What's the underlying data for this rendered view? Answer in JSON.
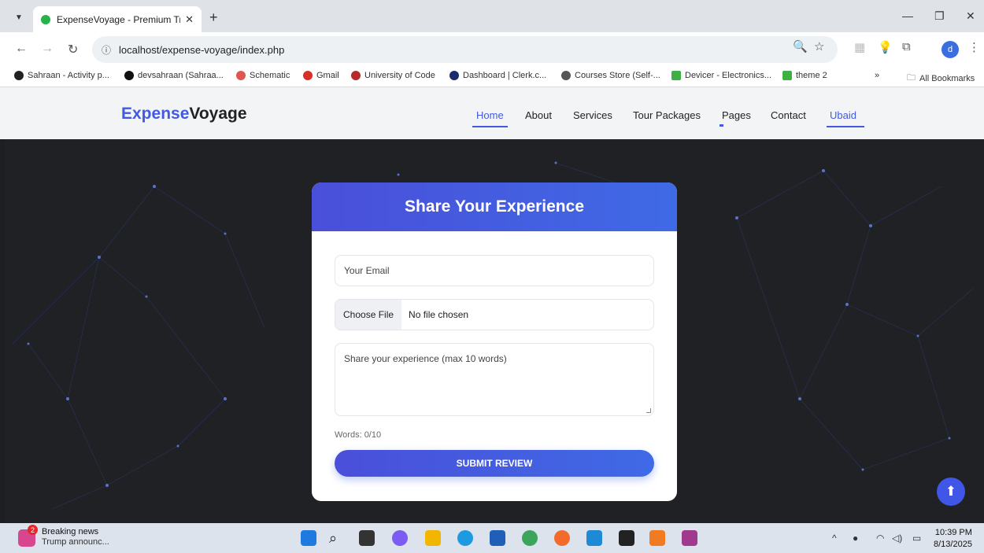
{
  "browser": {
    "tab_title": "ExpenseVoyage - Premium Trav",
    "url": "localhost/expense-voyage/index.php",
    "profile_initial": "d",
    "bookmarks": [
      "Sahraan - Activity p...",
      "devsahraan (Sahraa...",
      "Schematic",
      "Gmail",
      "University of Code",
      "Dashboard | Clerk.c...",
      "Courses Store (Self-...",
      "Devicer - Electronics...",
      "theme 2"
    ],
    "bookmarks_overflow": "»",
    "all_bookmarks": "All Bookmarks"
  },
  "site": {
    "logo_part1": "Expense",
    "logo_part2": "Voyage",
    "nav": [
      "Home",
      "About",
      "Services",
      "Tour Packages",
      "Pages",
      "Contact",
      "Ubaid"
    ]
  },
  "form": {
    "title": "Share Your Experience",
    "email_placeholder": "Your Email",
    "file_button": "Choose File",
    "file_status": "No file chosen",
    "experience_placeholder": "Share your experience (max 10 words)",
    "words_counter": "Words: 0/10",
    "submit_label": "SUBMIT REVIEW"
  },
  "taskbar": {
    "news_title": "Breaking news",
    "news_subtitle": "Trump announc...",
    "news_badge": "2",
    "time": "10:39 PM",
    "date": "8/13/2025"
  },
  "colors": {
    "accent": "#4259e0",
    "hero_bg": "#1f2124"
  }
}
